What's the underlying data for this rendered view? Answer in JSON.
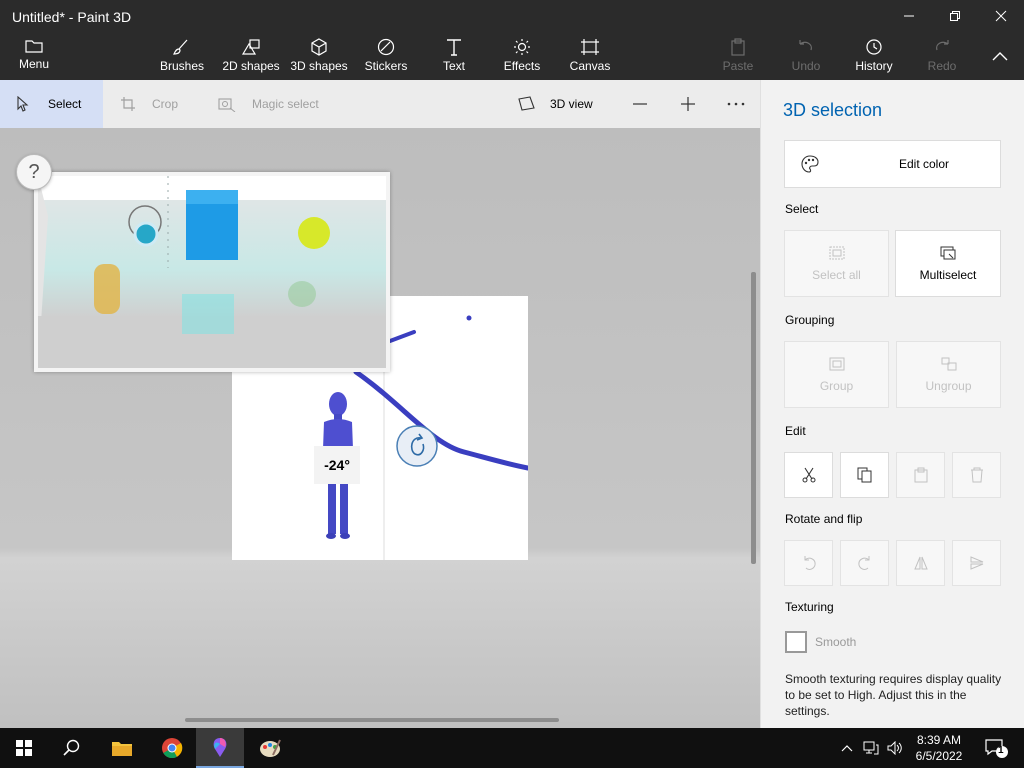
{
  "window": {
    "title": "Untitled* - Paint 3D"
  },
  "ribbon": {
    "menu_label": "Menu",
    "items": [
      {
        "label": "Brushes",
        "icon": "brush-icon"
      },
      {
        "label": "2D shapes",
        "icon": "2d-shapes-icon"
      },
      {
        "label": "3D shapes",
        "icon": "3d-shapes-icon"
      },
      {
        "label": "Stickers",
        "icon": "stickers-icon"
      },
      {
        "label": "Text",
        "icon": "text-icon"
      },
      {
        "label": "Effects",
        "icon": "effects-icon"
      },
      {
        "label": "Canvas",
        "icon": "canvas-icon"
      }
    ],
    "paste_label": "Paste",
    "undo_label": "Undo",
    "history_label": "History",
    "redo_label": "Redo"
  },
  "toolbar": {
    "select_label": "Select",
    "crop_label": "Crop",
    "magic_select_label": "Magic select",
    "view_label": "3D view"
  },
  "canvas": {
    "help_label": "?",
    "rotation_angle": "-24°"
  },
  "panel": {
    "title": "3D selection",
    "edit_color_label": "Edit color",
    "select_section": "Select",
    "select_all_label": "Select all",
    "multiselect_label": "Multiselect",
    "grouping_section": "Grouping",
    "group_label": "Group",
    "ungroup_label": "Ungroup",
    "edit_section": "Edit",
    "rotate_section": "Rotate and flip",
    "texturing_section": "Texturing",
    "smooth_label": "Smooth",
    "smooth_note": "Smooth texturing requires display quality to be set to High. Adjust this in the settings."
  },
  "taskbar": {
    "time": "8:39 AM",
    "date": "6/5/2022",
    "notification_count": "1"
  },
  "colors": {
    "accent": "#0063b1",
    "titlebar": "#2b2b2b",
    "selection": "#3a3ec0"
  }
}
